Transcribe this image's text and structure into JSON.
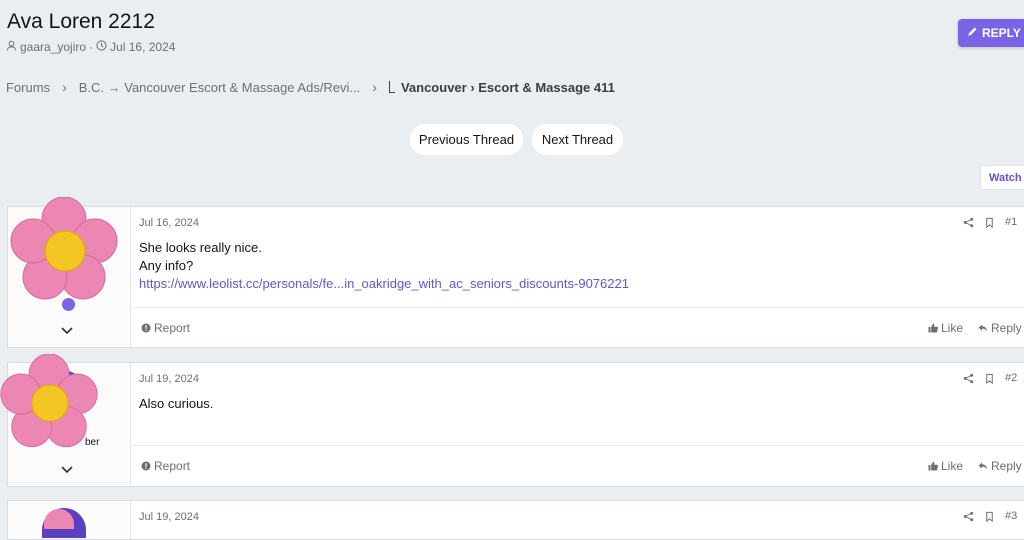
{
  "header": {
    "title": "Ava Loren 2212",
    "author": "gaara_yojiro",
    "meta_sep": "·",
    "date": "Jul 16, 2024",
    "reply_label": "REPLY"
  },
  "breadcrumb": {
    "items": [
      "Forums",
      "B.C. → Vancouver Escort & Massage Ads/Revi...",
      "Vancouver › Escort & Massage 411"
    ],
    "separator": "›"
  },
  "thread_nav": {
    "previous": "Previous Thread",
    "next": "Next Thread",
    "watch": "Watch"
  },
  "posts": [
    {
      "date": "Jul 16, 2024",
      "number": "#1",
      "lines": [
        "She looks really nice.",
        "Any info?"
      ],
      "link": "https://www.leolist.cc/personals/fe...in_oakridge_with_ac_seniors_discounts-9076221",
      "report": "Report",
      "like": "Like",
      "reply": "Reply"
    },
    {
      "date": "Jul 19, 2024",
      "number": "#2",
      "lines": [
        "Also curious."
      ],
      "role_fragment": "ber",
      "report": "Report",
      "like": "Like",
      "reply": "Reply"
    },
    {
      "date": "Jul 19, 2024",
      "number": "#3"
    }
  ],
  "colors": {
    "accent": "#7a63e4",
    "link": "#6c52c9",
    "flower_petal": "#ec86b3",
    "flower_center": "#f4c623"
  }
}
